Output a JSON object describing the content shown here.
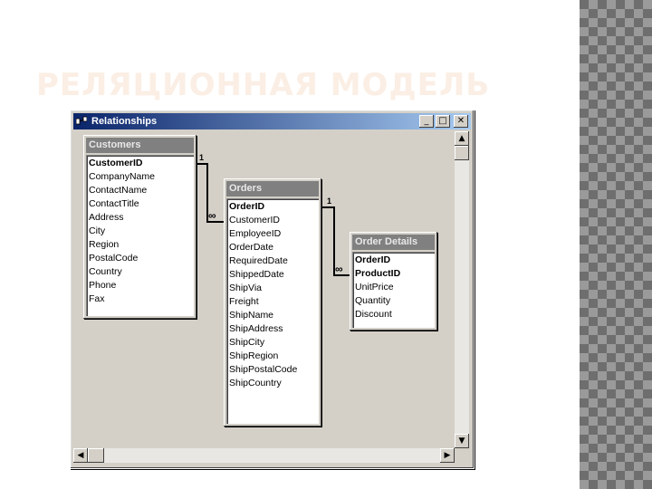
{
  "slide": {
    "title": "РЕЛЯЦИОННАЯ МОДЕЛЬ"
  },
  "window": {
    "title": "Relationships",
    "controls": {
      "minimize": "_",
      "maximize": "□",
      "close": "✕"
    }
  },
  "tables": {
    "customers": {
      "name": "Customers",
      "fields": [
        "CustomerID",
        "CompanyName",
        "ContactName",
        "ContactTitle",
        "Address",
        "City",
        "Region",
        "PostalCode",
        "Country",
        "Phone",
        "Fax"
      ],
      "primary_keys": [
        "CustomerID"
      ]
    },
    "orders": {
      "name": "Orders",
      "fields": [
        "OrderID",
        "CustomerID",
        "EmployeeID",
        "OrderDate",
        "RequiredDate",
        "ShippedDate",
        "ShipVia",
        "Freight",
        "ShipName",
        "ShipAddress",
        "ShipCity",
        "ShipRegion",
        "ShipPostalCode",
        "ShipCountry"
      ],
      "primary_keys": [
        "OrderID"
      ]
    },
    "order_details": {
      "name": "Order Details",
      "fields": [
        "OrderID",
        "ProductID",
        "UnitPrice",
        "Quantity",
        "Discount"
      ],
      "primary_keys": [
        "OrderID",
        "ProductID"
      ]
    }
  },
  "relationships": [
    {
      "from": "Customers",
      "to": "Orders",
      "one_label": "1",
      "many_label": "∞"
    },
    {
      "from": "Orders",
      "to": "Order Details",
      "one_label": "1",
      "many_label": "∞"
    }
  ],
  "colors": {
    "accent_title": "#0a246a",
    "slide_title": "#fbeee4"
  }
}
